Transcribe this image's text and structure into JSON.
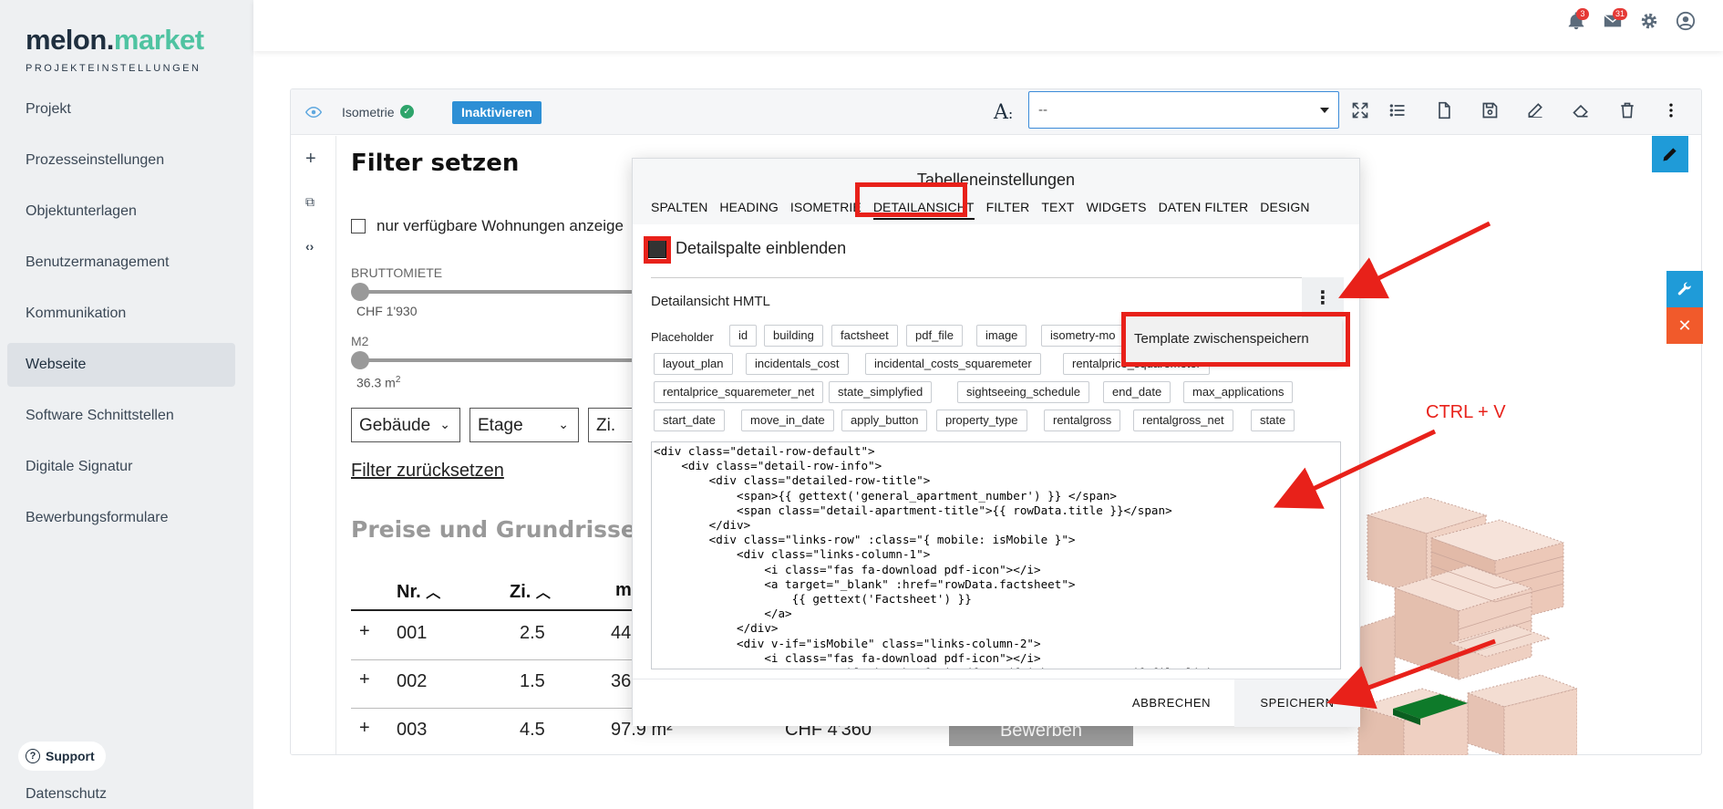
{
  "sidebar": {
    "logo_main": "melon.",
    "logo_accent": "market",
    "logo_sub": "PROJEKTEINSTELLUNGEN",
    "items": [
      {
        "label": "Projekt"
      },
      {
        "label": "Prozesseinstellungen"
      },
      {
        "label": "Objektunterlagen"
      },
      {
        "label": "Benutzermanagement"
      },
      {
        "label": "Kommunikation"
      },
      {
        "label": "Webseite"
      },
      {
        "label": "Software Schnittstellen"
      },
      {
        "label": "Digitale Signatur"
      },
      {
        "label": "Bewerbungsformulare"
      }
    ],
    "active_item": "Webseite",
    "support_label": "Support",
    "datenschutz_label": "Datenschutz"
  },
  "topbar": {
    "notifications_count": "3",
    "messages_count": "31",
    "icons": [
      "bell-icon",
      "mail-icon",
      "gear-icon",
      "user-icon"
    ]
  },
  "toolbar": {
    "element_label": "Isometrie",
    "deactivate_label": "Inaktivieren",
    "font_symbol": "A",
    "font_colon": ":",
    "select_value": "--",
    "icons": [
      "expand-icon",
      "list-icon",
      "file-icon",
      "save-icon",
      "edit-icon",
      "eraser-icon",
      "trash-icon",
      "more-vertical-icon"
    ]
  },
  "left_tools": {
    "add": "+",
    "copy": "⧉",
    "code": "‹›"
  },
  "page": {
    "filter_title": "Filter setzen",
    "only_available": "nur verfügbare Wohnungen anzeige",
    "bruttomiete_label": "BRUTTOMIETE",
    "bruttomiete_value": "CHF 1'930",
    "m2_label": "M2",
    "m2_value": "36.3 m",
    "m2_sup": "2",
    "dropdowns": [
      {
        "label": "Gebäude"
      },
      {
        "label": "Etage"
      },
      {
        "label": "Zi."
      }
    ],
    "reset_filter": "Filter zurücksetzen",
    "section_title": "Preise und Grundrisse",
    "table_headers": [
      "Nr.",
      "Zi.",
      "m"
    ],
    "rows": [
      {
        "expand": "+",
        "nr": "001",
        "zi": "2.5",
        "m2": "44"
      },
      {
        "expand": "+",
        "nr": "002",
        "zi": "1.5",
        "m2": "36"
      },
      {
        "expand": "+",
        "nr": "003",
        "zi": "4.5",
        "m2": "97.9 m²",
        "price": "CHF 4'360",
        "button": "Bewerben"
      }
    ]
  },
  "modal": {
    "title": "Tabelleneinstellungen",
    "tabs": [
      {
        "label": "SPALTEN"
      },
      {
        "label": "HEADING"
      },
      {
        "label": "ISOMETRIE"
      },
      {
        "label": "DETAILANSICHT"
      },
      {
        "label": "FILTER"
      },
      {
        "label": "TEXT"
      },
      {
        "label": "WIDGETS"
      },
      {
        "label": "DATEN FILTER"
      },
      {
        "label": "DESIGN"
      }
    ],
    "active_tab": "DETAILANSICHT",
    "detail_checkbox_label": "Detailspalte einblenden",
    "html_label": "Detailansicht HMTL",
    "placeholder_label": "Placeholder",
    "chips_row1": [
      "id",
      "building",
      "factsheet",
      "pdf_file",
      "image",
      "isometry-mo"
    ],
    "chips_row2": [
      "layout_plan",
      "incidentals_cost",
      "incidental_costs_squaremeter",
      "rentalprice_squaremeter"
    ],
    "chips_row3": [
      "rentalprice_squaremeter_net",
      "state_simplyfied",
      "sightseeing_schedule",
      "end_date",
      "max_applications"
    ],
    "chips_row4": [
      "start_date",
      "move_in_date",
      "apply_button",
      "property_type",
      "rentalgross",
      "rentalgross_net",
      "state"
    ],
    "template_menu_item": "Template zwischenspeichern",
    "code": "<div class=\"detail-row-default\">\n    <div class=\"detail-row-info\">\n        <div class=\"detailed-row-title\">\n            <span>{{ gettext('general_apartment_number') }} </span>\n            <span class=\"detail-apartment-title\">{{ rowData.title }}</span>\n        </div>\n        <div class=\"links-row\" :class=\"{ mobile: isMobile }\">\n            <div class=\"links-column-1\">\n                <i class=\"fas fa-download pdf-icon\"></i>\n                <a target=\"_blank\" :href=\"rowData.factsheet\">\n                    {{ gettext('Factsheet') }}\n                </a>\n            </div>\n            <div v-if=\"isMobile\" class=\"links-column-2\">\n                <i class=\"fas fa-download pdf-icon\"></i>\n                <a target=\"_blank\" :href=\"isPdf ? pdfLink : rowData.pdf_file_link\">",
    "cancel_label": "ABBRECHEN",
    "save_label": "SPEICHERN"
  },
  "annotations": {
    "ctrl_v": "CTRL + V",
    "color": "#e8211a"
  },
  "colors": {
    "accent_green": "#4fc3a1",
    "brand_blue": "#2d8fd5",
    "edit_blue": "#1f9bd8",
    "close_orange": "#f15a2b",
    "annotation_red": "#e8211a"
  }
}
